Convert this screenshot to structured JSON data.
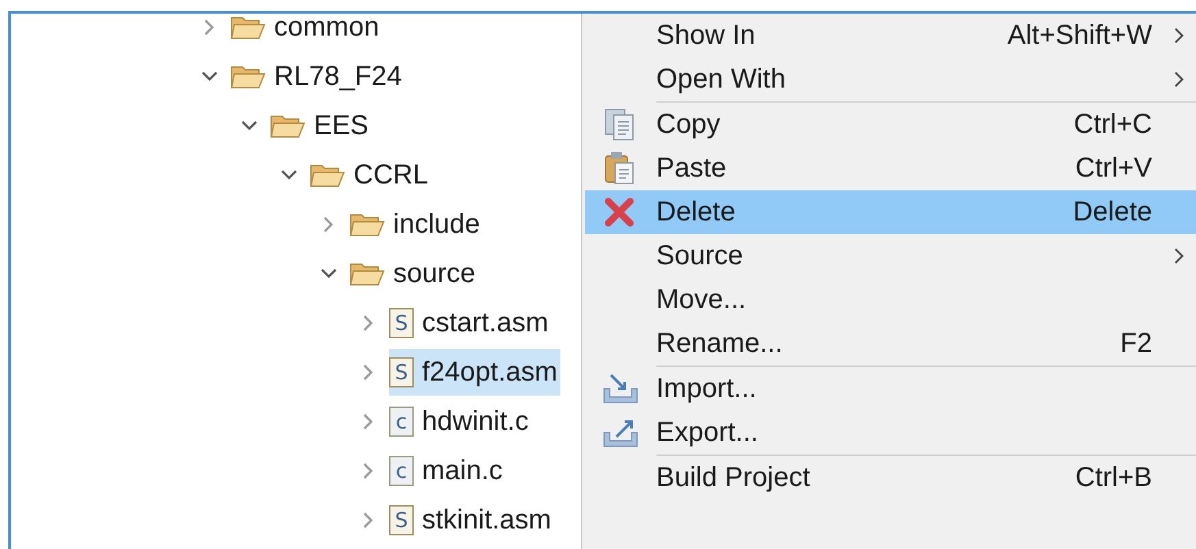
{
  "tree": [
    {
      "label": "common",
      "kind": "folder",
      "expanded": false,
      "selected": false
    },
    {
      "label": "RL78_F24",
      "kind": "folder",
      "expanded": true,
      "selected": false,
      "children": [
        {
          "label": "EES",
          "kind": "folder",
          "expanded": true,
          "selected": false,
          "children": [
            {
              "label": "CCRL",
              "kind": "folder",
              "expanded": true,
              "selected": false,
              "children": [
                {
                  "label": "include",
                  "kind": "folder",
                  "expanded": false,
                  "selected": false
                },
                {
                  "label": "source",
                  "kind": "folder",
                  "expanded": true,
                  "selected": false,
                  "children": [
                    {
                      "label": "cstart.asm",
                      "kind": "asm",
                      "icon_text": "S",
                      "expanded": false,
                      "selected": false
                    },
                    {
                      "label": "f24opt.asm",
                      "kind": "asm",
                      "icon_text": "S",
                      "expanded": false,
                      "selected": true
                    },
                    {
                      "label": "hdwinit.c",
                      "kind": "c",
                      "icon_text": "c",
                      "expanded": false,
                      "selected": false
                    },
                    {
                      "label": "main.c",
                      "kind": "c",
                      "icon_text": "c",
                      "expanded": false,
                      "selected": false
                    },
                    {
                      "label": "stkinit.asm",
                      "kind": "asm",
                      "icon_text": "S",
                      "expanded": false,
                      "selected": false
                    }
                  ]
                }
              ]
            }
          ]
        }
      ]
    }
  ],
  "context_menu": [
    {
      "kind": "item",
      "label": "Show In",
      "shortcut": "Alt+Shift+W",
      "submenu": true,
      "selected": false
    },
    {
      "kind": "item",
      "label": "Open With",
      "submenu": true,
      "selected": false
    },
    {
      "kind": "separator"
    },
    {
      "kind": "item",
      "label": "Copy",
      "shortcut": "Ctrl+C",
      "submenu": false,
      "selected": false
    },
    {
      "kind": "item",
      "label": "Paste",
      "shortcut": "Ctrl+V",
      "submenu": false,
      "selected": false
    },
    {
      "kind": "item",
      "label": "Delete",
      "shortcut": "Delete",
      "submenu": false,
      "selected": true
    },
    {
      "kind": "item",
      "label": "Source",
      "submenu": true,
      "selected": false
    },
    {
      "kind": "item",
      "label": "Move...",
      "submenu": false,
      "selected": false
    },
    {
      "kind": "item",
      "label": "Rename...",
      "shortcut": "F2",
      "submenu": false,
      "selected": false
    },
    {
      "kind": "separator"
    },
    {
      "kind": "item",
      "label": "Import...",
      "submenu": false,
      "selected": false
    },
    {
      "kind": "item",
      "label": "Export...",
      "submenu": false,
      "selected": false
    },
    {
      "kind": "separator"
    },
    {
      "kind": "item",
      "label": "Build Project",
      "shortcut": "Ctrl+B",
      "submenu": false,
      "selected": false
    }
  ]
}
